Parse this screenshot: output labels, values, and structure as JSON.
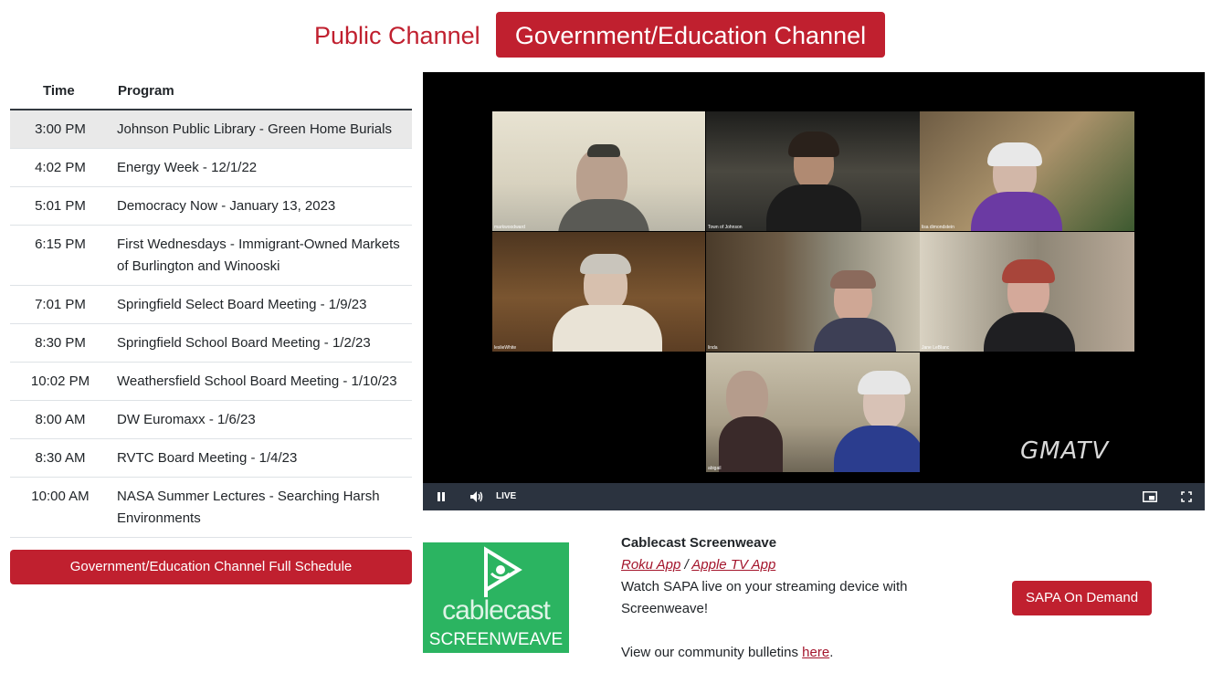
{
  "tabs": {
    "public": "Public Channel",
    "government": "Government/Education Channel"
  },
  "schedule": {
    "headers": {
      "time": "Time",
      "program": "Program"
    },
    "rows": [
      {
        "time": "3:00 PM",
        "program": "Johnson Public Library - Green Home Burials"
      },
      {
        "time": "4:02 PM",
        "program": "Energy Week - 12/1/22"
      },
      {
        "time": "5:01 PM",
        "program": "Democracy Now - January 13, 2023"
      },
      {
        "time": "6:15 PM",
        "program": "First Wednesdays - Immigrant-Owned Markets of Burlington and Winooski"
      },
      {
        "time": "7:01 PM",
        "program": "Springfield Select Board Meeting - 1/9/23"
      },
      {
        "time": "8:30 PM",
        "program": "Springfield School Board Meeting - 1/2/23"
      },
      {
        "time": "10:02 PM",
        "program": "Weathersfield School Board Meeting - 1/10/23"
      },
      {
        "time": "8:00 AM",
        "program": "DW Euromaxx - 1/6/23"
      },
      {
        "time": "8:30 AM",
        "program": "RVTC Board Meeting - 1/4/23"
      },
      {
        "time": "10:00 AM",
        "program": "NASA Summer Lectures - Searching Harsh Environments"
      }
    ],
    "full_schedule_label": "Government/Education Channel Full Schedule"
  },
  "player": {
    "live_label": "LIVE",
    "watermark": "GMATV",
    "participants": [
      "markwoodward",
      "Town of Johnson",
      "lisa dimondstein",
      "leslieWhite",
      "linda",
      "Jane LeBlanc",
      "abigail"
    ],
    "icons": {
      "play_pause": "pause-icon",
      "volume": "volume-icon",
      "pip": "picture-in-picture-icon",
      "fullscreen": "fullscreen-icon"
    }
  },
  "screenweave": {
    "logo_line1": "cablecast",
    "logo_line2": "SCREENWEAVE",
    "title": "Cablecast Screenweave",
    "roku_link": "Roku App",
    "separator": " / ",
    "apple_link": "Apple TV App",
    "description": "Watch SAPA live on your streaming device with Screenweave!",
    "bulletins_prefix": "View our community bulletins ",
    "bulletins_link": "here",
    "bulletins_suffix": "."
  },
  "on_demand_label": "SAPA On Demand"
}
